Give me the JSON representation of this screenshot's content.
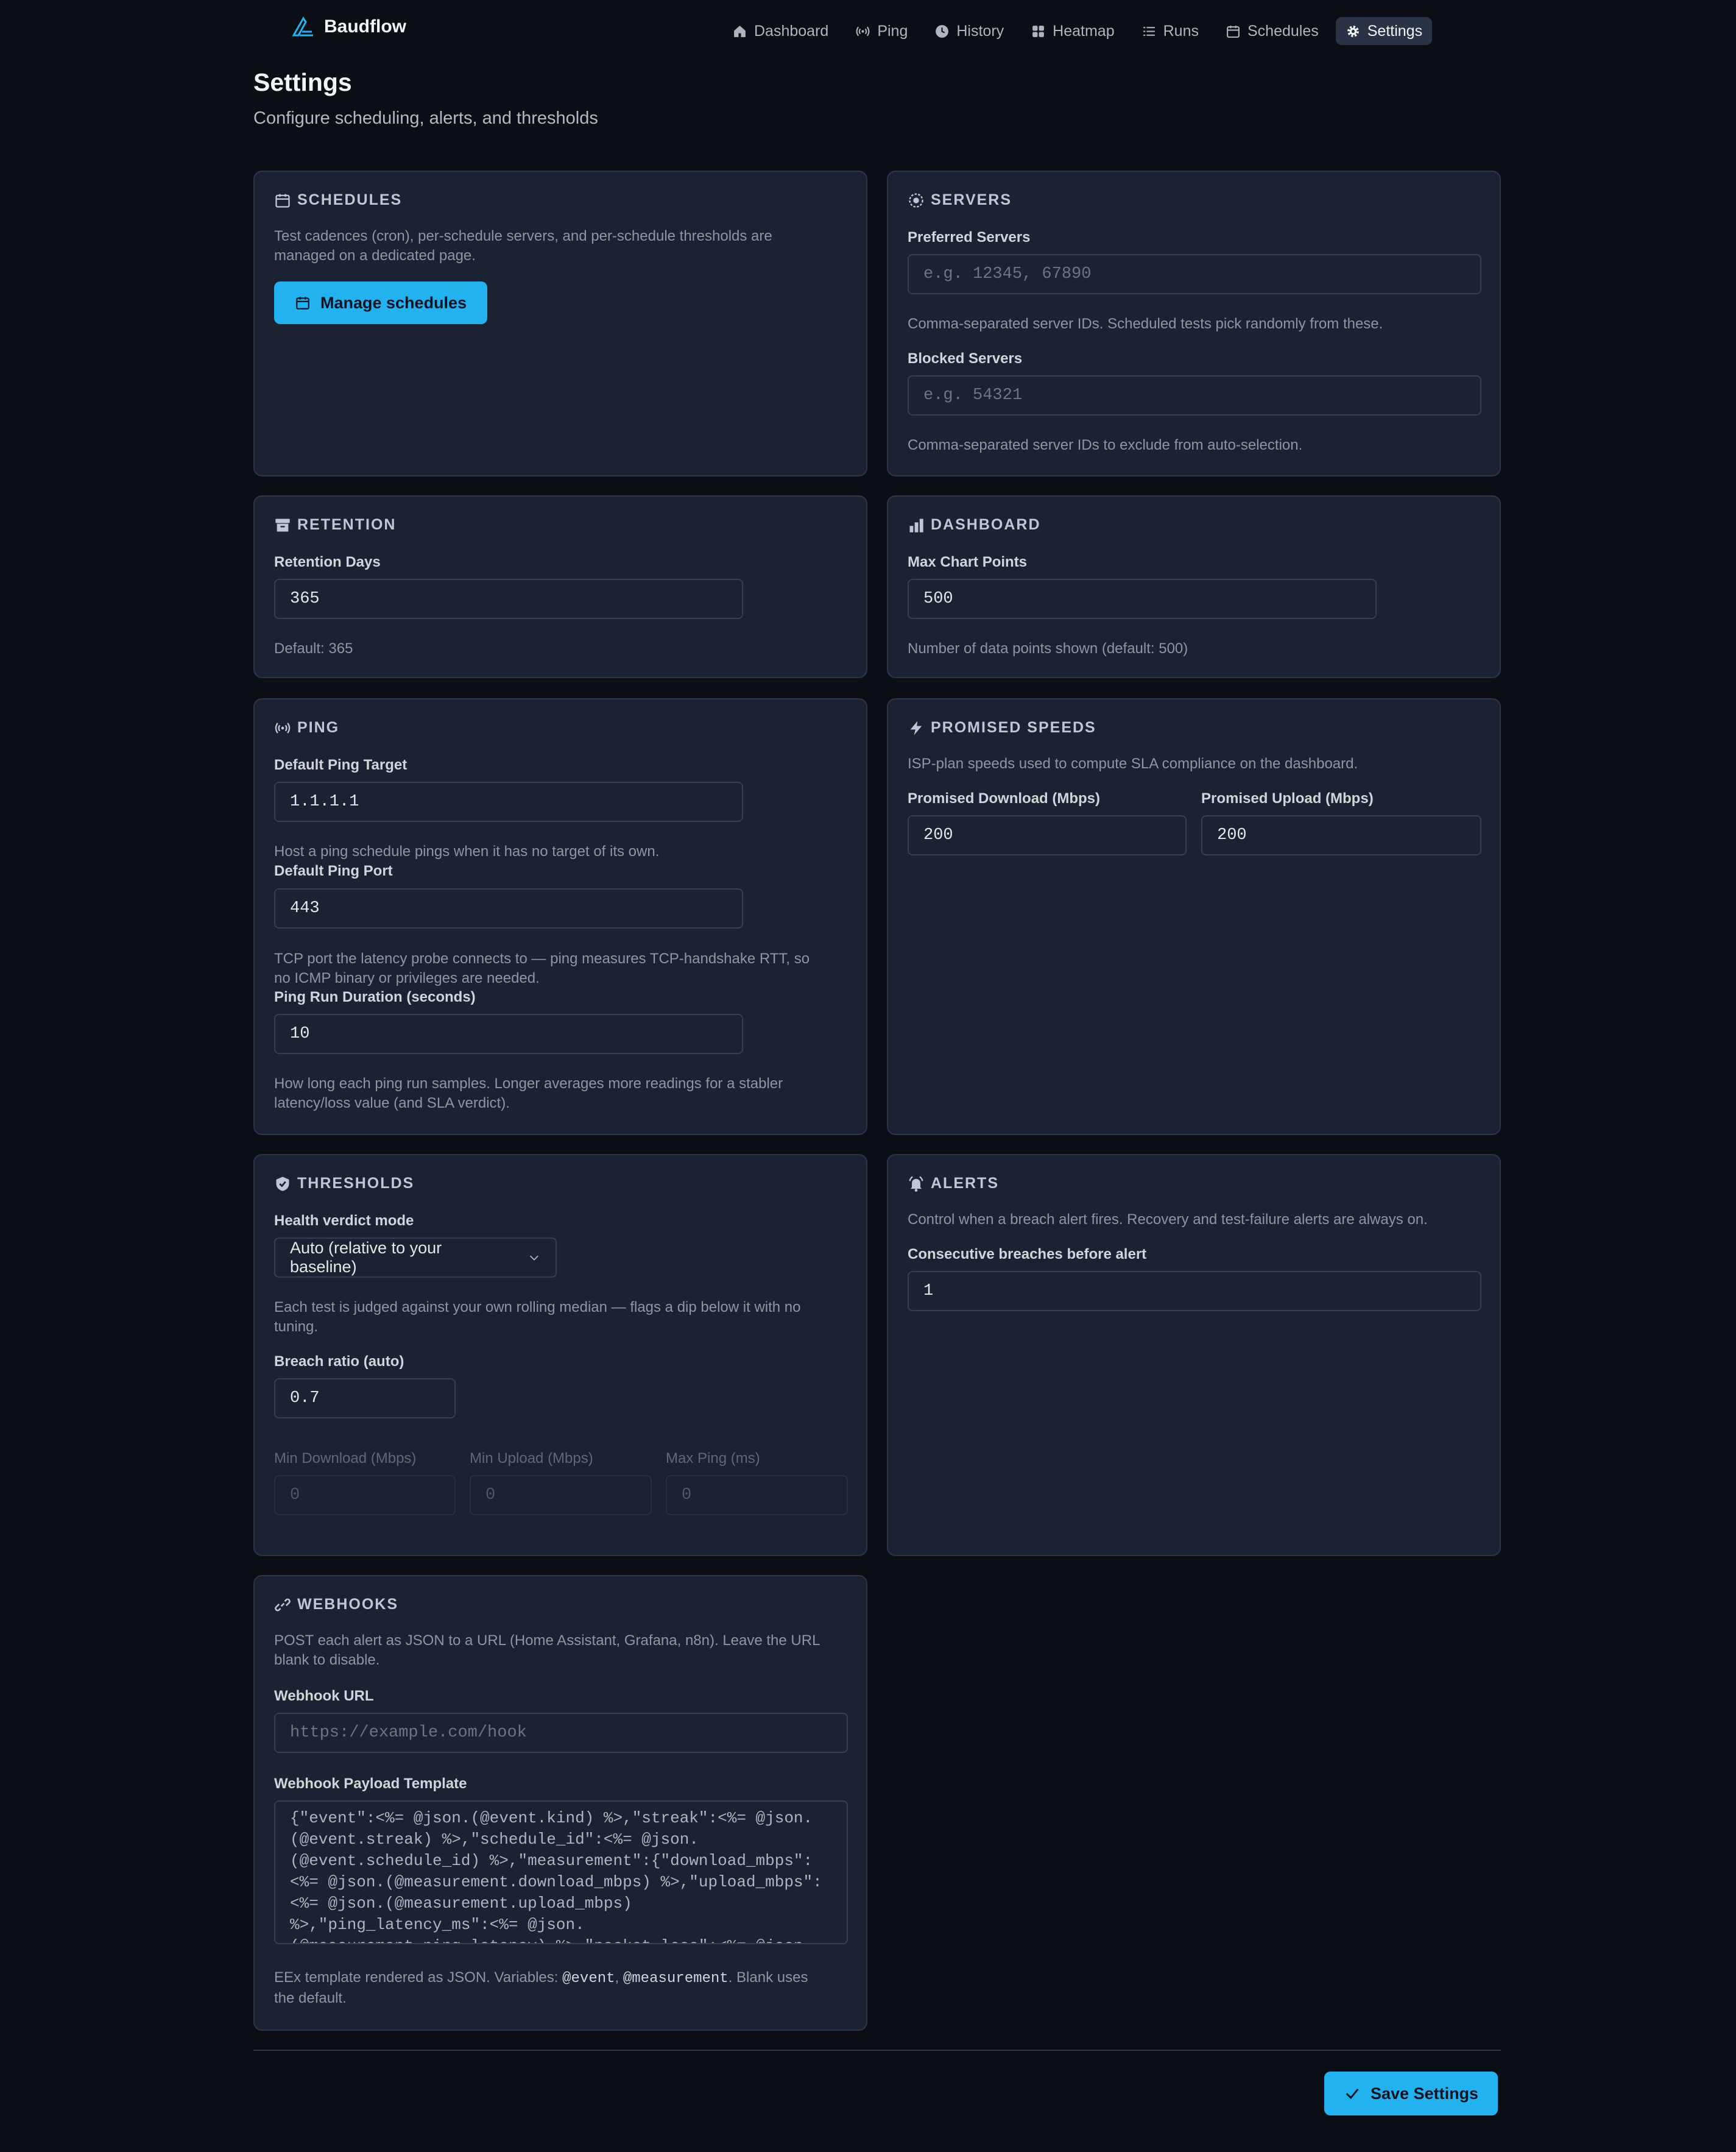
{
  "app": {
    "name": "Baudflow"
  },
  "nav": [
    {
      "label": "Dashboard",
      "icon": "home-icon",
      "active": false
    },
    {
      "label": "Ping",
      "icon": "signal-icon",
      "active": false
    },
    {
      "label": "History",
      "icon": "clock-icon",
      "active": false
    },
    {
      "label": "Heatmap",
      "icon": "grid-icon",
      "active": false
    },
    {
      "label": "Runs",
      "icon": "list-icon",
      "active": false
    },
    {
      "label": "Schedules",
      "icon": "calendar-icon",
      "active": false
    },
    {
      "label": "Settings",
      "icon": "gear-icon",
      "active": true
    }
  ],
  "page": {
    "title": "Settings",
    "subtitle": "Configure scheduling, alerts, and thresholds"
  },
  "schedules": {
    "title": "SCHEDULES",
    "desc_line1": "Test cadences (cron), per-schedule servers, and per-schedule thresholds are",
    "desc_line2": "managed on a dedicated page.",
    "button": "Manage schedules"
  },
  "servers": {
    "title": "SERVERS",
    "preferred_label": "Preferred Servers",
    "preferred_placeholder": "e.g. 12345, 67890",
    "preferred_hint": "Comma-separated server IDs. Scheduled tests pick randomly from these.",
    "blocked_label": "Blocked Servers",
    "blocked_placeholder": "e.g. 54321",
    "blocked_hint": "Comma-separated server IDs to exclude from auto-selection."
  },
  "retention": {
    "title": "RETENTION",
    "label": "Retention Days",
    "value": "365",
    "hint": "Default: 365"
  },
  "dashboard": {
    "title": "DASHBOARD",
    "label": "Max Chart Points",
    "value": "500",
    "hint": "Number of data points shown (default: 500)"
  },
  "ping": {
    "title": "PING",
    "target_label": "Default Ping Target",
    "target_value": "1.1.1.1",
    "target_hint": "Host a ping schedule pings when it has no target of its own.",
    "port_label": "Default Ping Port",
    "port_value": "443",
    "port_hint_line1": "TCP port the latency probe connects to — ping measures TCP-handshake RTT, so",
    "port_hint_line2": "no ICMP binary or privileges are needed.",
    "duration_label": "Ping Run Duration (seconds)",
    "duration_value": "10",
    "duration_hint_line1": "How long each ping run samples. Longer averages more readings for a stabler",
    "duration_hint_line2": "latency/loss value (and SLA verdict)."
  },
  "promised": {
    "title": "PROMISED SPEEDS",
    "desc": "ISP-plan speeds used to compute SLA compliance on the dashboard.",
    "download_label": "Promised Download (Mbps)",
    "download_value": "200",
    "upload_label": "Promised Upload (Mbps)",
    "upload_value": "200"
  },
  "thresholds": {
    "title": "THRESHOLDS",
    "mode_label": "Health verdict mode",
    "mode_value": "Auto (relative to your baseline)",
    "mode_hint_line1": "Each test is judged against your own rolling median — flags a dip below it with no",
    "mode_hint_line2": "tuning.",
    "ratio_label": "Breach ratio (auto)",
    "ratio_value": "0.7",
    "min_download_label": "Min Download (Mbps)",
    "min_download_value": "0",
    "min_upload_label": "Min Upload (Mbps)",
    "min_upload_value": "0",
    "max_ping_label": "Max Ping (ms)",
    "max_ping_value": "0"
  },
  "alerts": {
    "title": "ALERTS",
    "desc": "Control when a breach alert fires. Recovery and test-failure alerts are always on.",
    "label": "Consecutive breaches before alert",
    "value": "1"
  },
  "webhooks": {
    "title": "WEBHOOKS",
    "desc_line1": "POST each alert as JSON to a URL (Home Assistant, Grafana, n8n). Leave the URL",
    "desc_line2": "blank to disable.",
    "url_label": "Webhook URL",
    "url_placeholder": "https://example.com/hook",
    "template_label": "Webhook Payload Template",
    "template_lines": [
      "{\"event\":<%= @json.(@event.kind) %>,\"streak\":<%= @json.",
      "(@event.streak) %>,\"schedule_id\":<%= @json.",
      "(@event.schedule_id) %>,\"measurement\":{\"download_mbps\":",
      "<%= @json.(@measurement.download_mbps) %>,\"upload_mbps\":",
      "<%= @json.(@measurement.upload_mbps)",
      "%>,\"ping_latency_ms\":<%= @json.",
      "(@measurement.ping_latency) %>,\"packet_loss\":<%= @json."
    ],
    "hint_prefix": "EEx template rendered as JSON. Variables: ",
    "var_event": "@event",
    "hint_sep": ", ",
    "var_measurement": "@measurement",
    "hint_suffix": ". Blank uses",
    "hint_line2": "the default."
  },
  "footer": {
    "save": "Save Settings"
  },
  "colors": {
    "accent": "#22b2f0",
    "background": "#0b0e15",
    "card": "#1b2232"
  }
}
